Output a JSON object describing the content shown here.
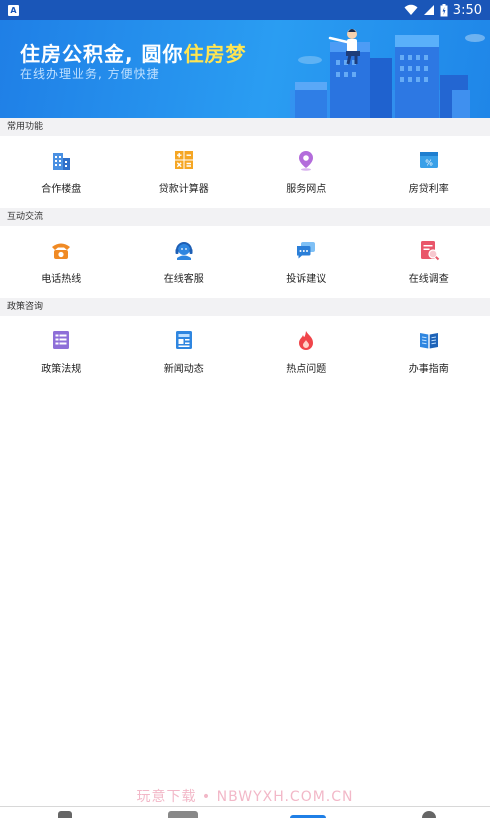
{
  "status_bar": {
    "app_icon_letter": "A",
    "time": "3:50"
  },
  "banner": {
    "title_main": "住房公积金, 圆你",
    "title_highlight": "住房梦",
    "subtitle": "在线办理业务, 方便快捷"
  },
  "sections": [
    {
      "title": "常用功能",
      "items": [
        {
          "label": "合作楼盘",
          "icon": "building-icon"
        },
        {
          "label": "贷款计算器",
          "icon": "calculator-icon"
        },
        {
          "label": "服务网点",
          "icon": "location-pin-icon"
        },
        {
          "label": "房贷利率",
          "icon": "rate-card-icon"
        }
      ]
    },
    {
      "title": "互动交流",
      "items": [
        {
          "label": "电话热线",
          "icon": "phone-icon"
        },
        {
          "label": "在线客服",
          "icon": "headset-icon"
        },
        {
          "label": "投诉建议",
          "icon": "chat-icon"
        },
        {
          "label": "在线调查",
          "icon": "survey-icon"
        }
      ]
    },
    {
      "title": "政策咨询",
      "items": [
        {
          "label": "政策法规",
          "icon": "document-icon"
        },
        {
          "label": "新闻动态",
          "icon": "news-icon"
        },
        {
          "label": "热点问题",
          "icon": "flame-icon"
        },
        {
          "label": "办事指南",
          "icon": "book-icon"
        }
      ]
    }
  ],
  "watermark": "玩意下载 • NBWYXH.COM.CN",
  "colors": {
    "status_bar": "#1a56b8",
    "banner_start": "#1f7fe6",
    "banner_end": "#2a9df2",
    "highlight": "#ffe552",
    "section_bg": "#f2f2f4"
  }
}
